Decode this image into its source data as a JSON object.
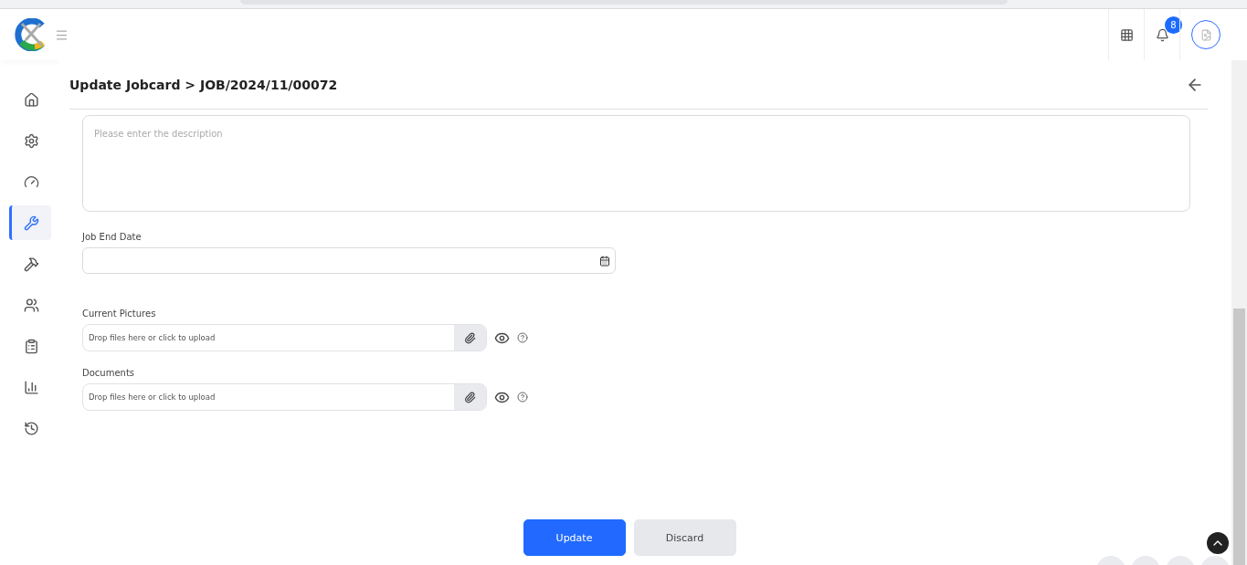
{
  "header": {
    "notification_count": "8"
  },
  "sidebar": {
    "items": [
      {
        "selected": false
      },
      {
        "selected": false
      },
      {
        "selected": false
      },
      {
        "selected": true
      },
      {
        "selected": false
      },
      {
        "selected": false
      },
      {
        "selected": false
      },
      {
        "selected": false
      },
      {
        "selected": false
      }
    ]
  },
  "page": {
    "title": "Update Jobcard > JOB/2024/11/00072"
  },
  "form": {
    "description": {
      "placeholder": "Please enter the description"
    },
    "end_date": {
      "label": "Job End Date"
    },
    "uploads": [
      {
        "label": "Current Pictures",
        "placeholder": "Drop files here or click to upload"
      },
      {
        "label": "Documents",
        "placeholder": "Drop files here or click to upload"
      }
    ]
  },
  "buttons": [
    {
      "label": "Update",
      "kind": "primary"
    },
    {
      "label": "Discard",
      "kind": "secondary"
    }
  ]
}
